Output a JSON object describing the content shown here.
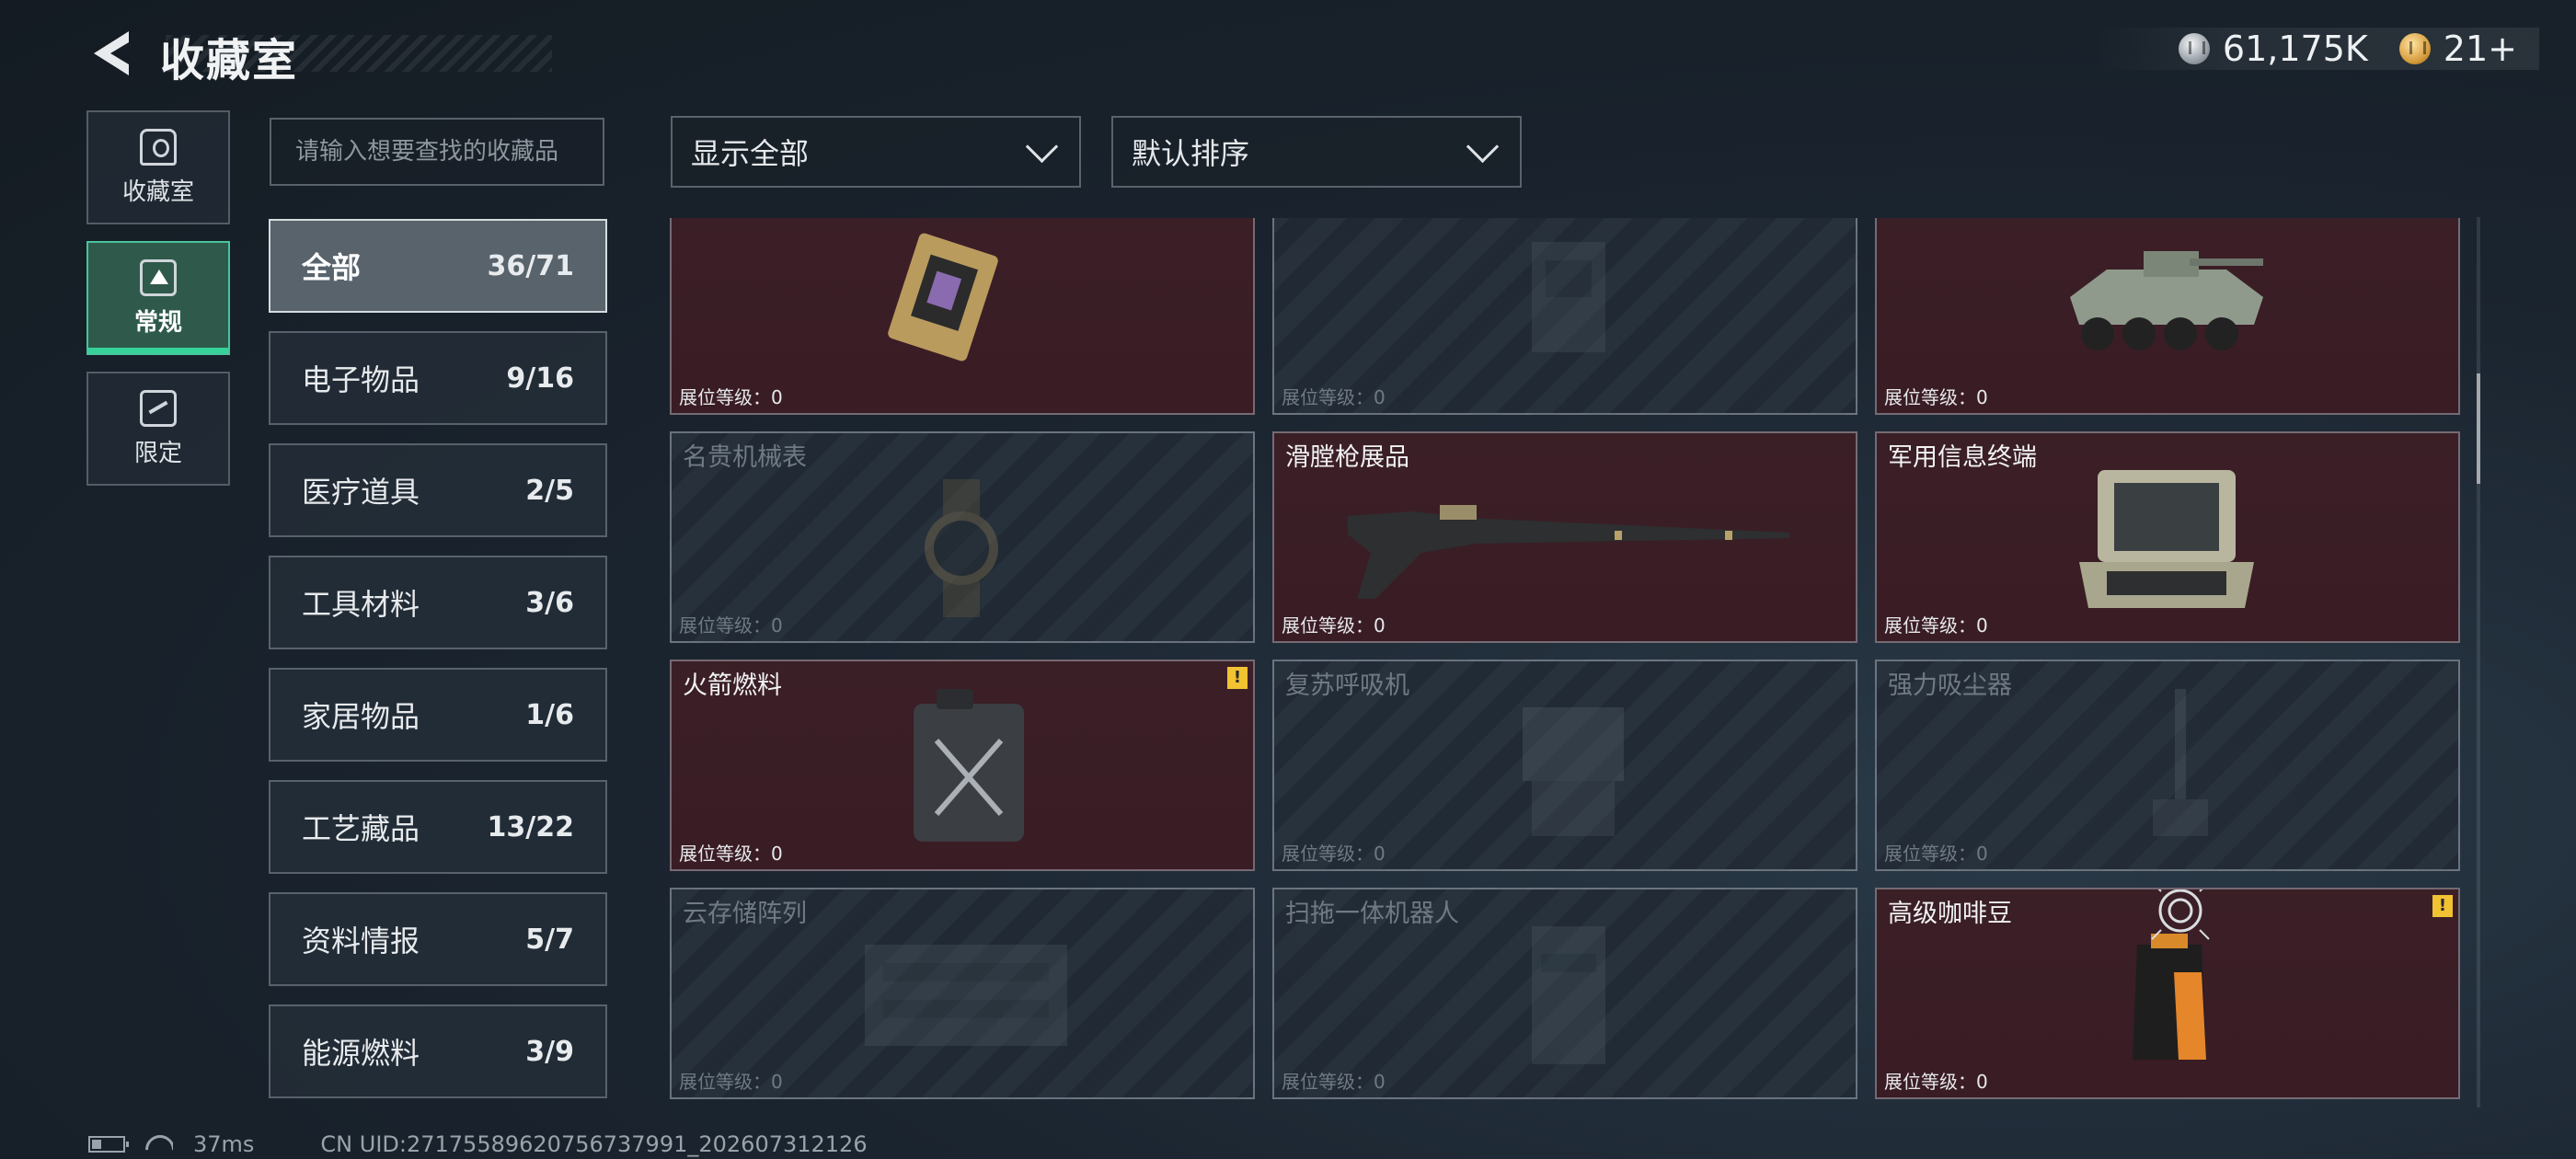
{
  "header": {
    "title": "收藏室",
    "currencies": [
      {
        "icon": "silver-coin-icon",
        "value": "61,175K"
      },
      {
        "icon": "gold-coin-icon",
        "value": "21+"
      }
    ]
  },
  "rail": [
    {
      "label": "收藏室",
      "icon": "trophy-icon",
      "active": false
    },
    {
      "label": "常规",
      "icon": "document-icon",
      "active": true
    },
    {
      "label": "限定",
      "icon": "limited-icon",
      "active": false
    }
  ],
  "search": {
    "placeholder": "请输入想要查找的收藏品"
  },
  "filters": {
    "display": "显示全部",
    "sort": "默认排序"
  },
  "categories": [
    {
      "name": "全部",
      "count": "36/71",
      "active": true
    },
    {
      "name": "电子物品",
      "count": "9/16",
      "active": false
    },
    {
      "name": "医疗道具",
      "count": "2/5",
      "active": false
    },
    {
      "name": "工具材料",
      "count": "3/6",
      "active": false
    },
    {
      "name": "家居物品",
      "count": "1/6",
      "active": false
    },
    {
      "name": "工艺藏品",
      "count": "13/22",
      "active": false
    },
    {
      "name": "资料情报",
      "count": "5/7",
      "active": false
    },
    {
      "name": "能源燃料",
      "count": "3/9",
      "active": false
    }
  ],
  "level_label": "展位等级：0",
  "cards": [
    {
      "name": "",
      "owned": true,
      "warn": false
    },
    {
      "name": "",
      "owned": false,
      "warn": false
    },
    {
      "name": "",
      "owned": true,
      "warn": false
    },
    {
      "name": "名贵机械表",
      "owned": false,
      "warn": false
    },
    {
      "name": "滑膛枪展品",
      "owned": true,
      "warn": false
    },
    {
      "name": "军用信息终端",
      "owned": true,
      "warn": false
    },
    {
      "name": "火箭燃料",
      "owned": true,
      "warn": true
    },
    {
      "name": "复苏呼吸机",
      "owned": false,
      "warn": false
    },
    {
      "name": "强力吸尘器",
      "owned": false,
      "warn": false
    },
    {
      "name": "云存储阵列",
      "owned": false,
      "warn": false
    },
    {
      "name": "扫拖一体机器人",
      "owned": false,
      "warn": false
    },
    {
      "name": "高级咖啡豆",
      "owned": true,
      "warn": true
    }
  ],
  "status": {
    "ping": "37ms",
    "uid": "CN UID:271755896207567379​91_202607312126"
  }
}
